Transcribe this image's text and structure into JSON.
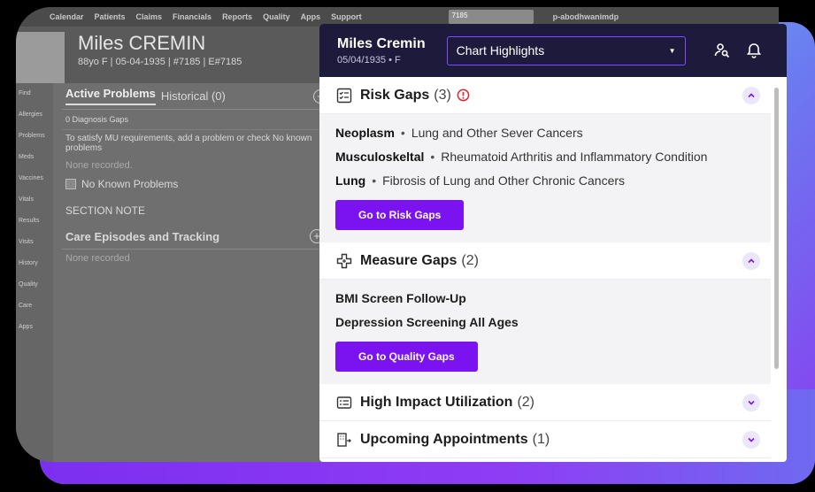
{
  "background_app": {
    "nav": [
      "Calendar",
      "Patients",
      "Claims",
      "Financials",
      "Reports",
      "Quality",
      "Apps",
      "Support"
    ],
    "search_value": "7185",
    "user": "p-abodhwanimdp",
    "patient_name": "Miles CREMIN",
    "patient_sub": "88yo F  |  05-04-1935  |  #7185  |  E#7185",
    "side_nav": [
      "Find",
      "Allergies",
      "Problems",
      "Meds",
      "Vaccines",
      "Vitals",
      "Results",
      "Visits",
      "History",
      "Quality",
      "Care",
      "Apps"
    ],
    "tab_active": "Active Problems",
    "tab_historical": "Historical (0)",
    "diag_gaps": "0 Diagnosis Gaps",
    "mu_text": "To satisfy MU requirements, add a problem or check No known problems",
    "none_recorded": "None recorded.",
    "no_known": "No Known Problems",
    "section_note": "SECTION NOTE",
    "care_episodes": "Care Episodes and Tracking",
    "care_none": "None recorded"
  },
  "panel": {
    "patient_name": "Miles Cremin",
    "patient_meta": "05/04/1935  •  F",
    "dropdown_value": "Chart Highlights",
    "icons": {
      "user_search": "user-search-icon",
      "bell": "bell-icon"
    },
    "accent": "#7b13f0",
    "sections": {
      "risk": {
        "title": "Risk Gaps",
        "count": "(3)",
        "items": [
          {
            "label": "Neoplasm",
            "desc": "Lung and Other Sever Cancers"
          },
          {
            "label": "Musculoskeltal",
            "desc": "Rheumatoid Arthritis and Inflammatory Condition"
          },
          {
            "label": "Lung",
            "desc": "Fibrosis of Lung and Other Chronic Cancers"
          }
        ],
        "button": "Go to Risk Gaps"
      },
      "measure": {
        "title": "Measure Gaps",
        "count": "(2)",
        "items": [
          "BMI Screen Follow-Up",
          "Depression Screening All Ages"
        ],
        "button": "Go to Quality Gaps"
      },
      "utilization": {
        "title": "High Impact Utilization",
        "count": "(2)"
      },
      "appointments": {
        "title": "Upcoming Appointments",
        "count": "(1)"
      }
    }
  }
}
